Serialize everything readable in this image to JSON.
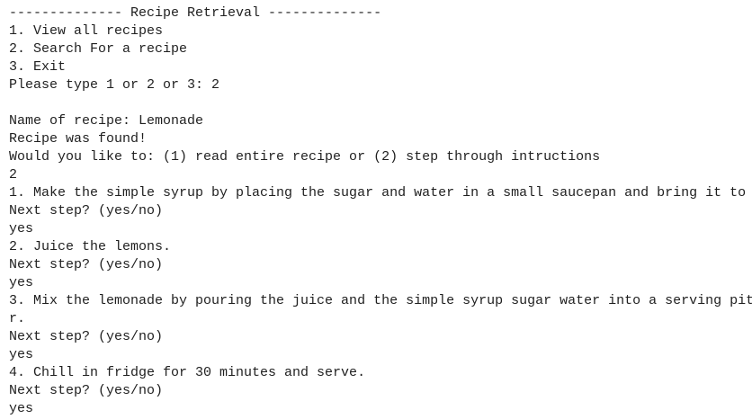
{
  "console": {
    "lines": [
      "-------------- Recipe Retrieval --------------",
      "1. View all recipes",
      "2. Search For a recipe",
      "3. Exit",
      "Please type 1 or 2 or 3: 2",
      "",
      "Name of recipe: Lemonade",
      "Recipe was found!",
      "Would you like to: (1) read entire recipe or (2) step through intructions",
      "2",
      "1. Make the simple syrup by placing the sugar and water in a small saucepan and bring it to",
      "Next step? (yes/no)",
      "yes",
      "2. Juice the lemons.",
      "Next step? (yes/no)",
      "yes",
      "3. Mix the lemonade by pouring the juice and the simple syrup sugar water into a serving pit",
      "r.",
      "Next step? (yes/no)",
      "yes",
      "4. Chill in fridge for 30 minutes and serve.",
      "Next step? (yes/no)",
      "yes"
    ]
  }
}
